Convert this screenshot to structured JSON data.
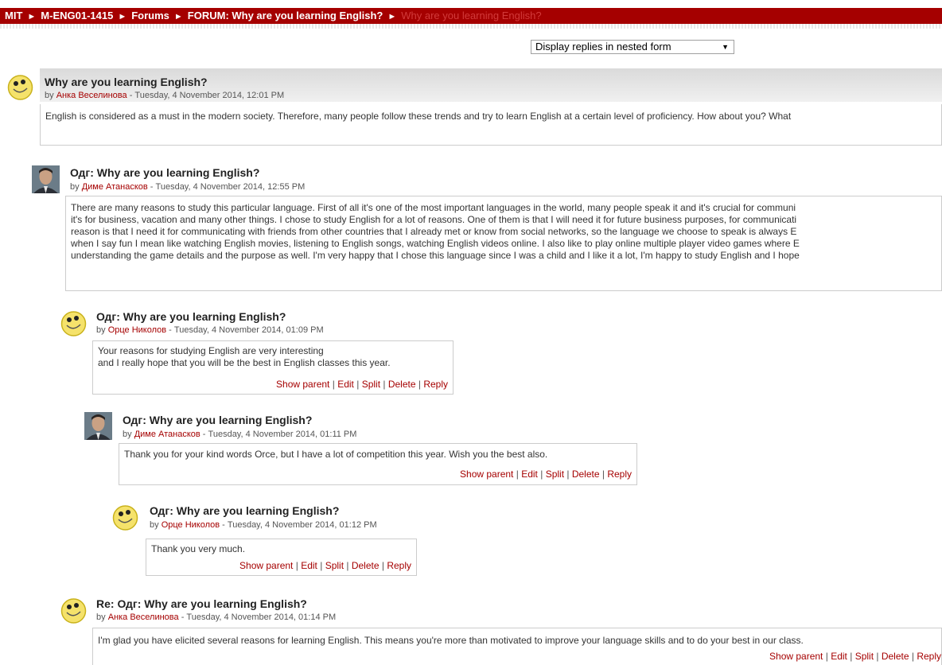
{
  "breadcrumb": {
    "items": [
      "MIT",
      "M-ENG01-1415",
      "Forums",
      "FORUM: Why are you learning English?"
    ],
    "current": "Why are you learning English?"
  },
  "display_mode": {
    "selected": "Display replies in nested form"
  },
  "commands": {
    "show_parent": "Show parent",
    "edit": "Edit",
    "split": "Split",
    "delete": "Delete",
    "reply": "Reply"
  },
  "posts": [
    {
      "subject": "Why are you learning English?",
      "by": "by",
      "author": "Анка Веселинова",
      "date": " - Tuesday, 4 November 2014, 12:01 PM",
      "lines": [
        "English is considered as a must in the modern society. Therefore, many people follow these trends and try to learn English at a certain level of proficiency. How about you? What"
      ]
    },
    {
      "subject": "Одг: Why are you learning English?",
      "by": "by",
      "author": "Диме Атанасков",
      "date": " - Tuesday, 4 November 2014, 12:55 PM",
      "lines": [
        "There are many reasons to study this particular language. First of all it's one of the most important languages in the world, many people speak it and it's crucial for communi",
        "it's for business, vacation and many other things. I chose to study English for a lot of reasons. One of them is that I will need it for future business purposes, for communicati",
        "reason is that I need it for communicating with friends from other countries that I already met or know from social networks, so the language we choose to speak is always E",
        "when I say fun I mean like watching English movies, listening to English songs, watching English videos online. I also like to play online multiple player video games where E",
        "understanding the game details and the purpose as well. I'm very happy that I chose this language since I was a child and I like it a lot, I'm happy to study English and I hope"
      ]
    },
    {
      "subject": "Одг: Why are you learning English?",
      "by": "by",
      "author": "Орце Николов",
      "date": " - Tuesday, 4 November 2014, 01:09 PM",
      "lines": [
        "Your reasons for studying English are very interesting",
        "and I really hope that you will be the best in English classes this year."
      ]
    },
    {
      "subject": "Одг: Why are you learning English?",
      "by": "by",
      "author": "Диме Атанасков",
      "date": " - Tuesday, 4 November 2014, 01:11 PM",
      "lines": [
        "Thank you for your kind words Orce, but I have a lot of competition this year. Wish you the best also."
      ]
    },
    {
      "subject": "Одг: Why are you learning English?",
      "by": "by",
      "author": "Орце Николов",
      "date": " - Tuesday, 4 November 2014, 01:12 PM",
      "lines": [
        "Thank you very much."
      ]
    },
    {
      "subject": "Re: Одг: Why are you learning English?",
      "by": "by",
      "author": "Анка Веселинова",
      "date": " - Tuesday, 4 November 2014, 01:14 PM",
      "lines": [
        "I'm glad you have elicited several reasons for learning English. This means you're more than motivated to improve your language skills and to do your best in our class."
      ]
    }
  ]
}
